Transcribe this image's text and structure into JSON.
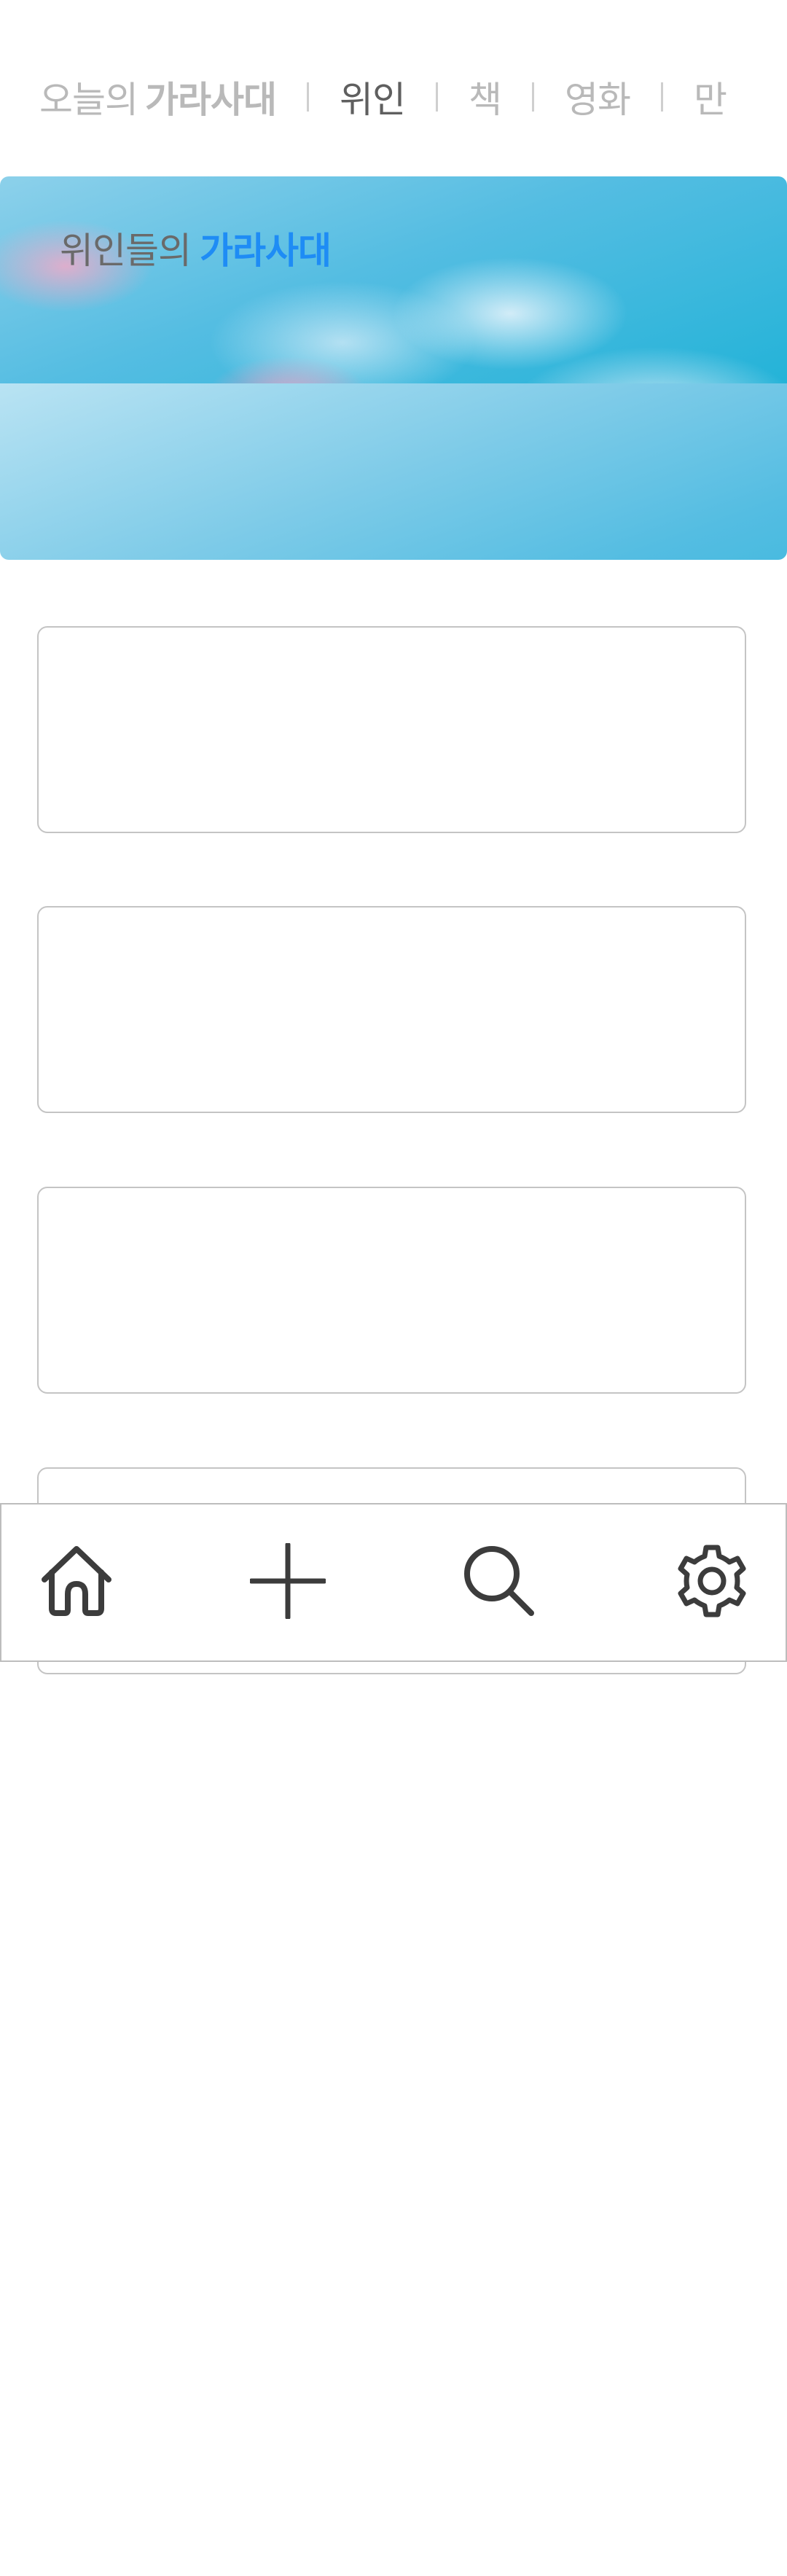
{
  "tabs": [
    {
      "label_light": "오늘의",
      "label_bold": "가라사대",
      "active": false
    },
    {
      "label": "위인",
      "active": true
    },
    {
      "label": "책",
      "active": false
    },
    {
      "label": "영화",
      "active": false
    },
    {
      "label": "만",
      "active": false
    }
  ],
  "hero": {
    "title_part1": "위인들의",
    "title_part2": "가라사대",
    "accent_color": "#1e8cf5"
  },
  "cards": [
    {
      "text": ""
    },
    {
      "text": ""
    },
    {
      "text": ""
    },
    {
      "text": ""
    }
  ],
  "bottom_nav": {
    "items": [
      {
        "icon": "home-icon"
      },
      {
        "icon": "plus-icon"
      },
      {
        "icon": "search-icon"
      },
      {
        "icon": "gear-icon"
      }
    ]
  },
  "colors": {
    "tab_inactive": "#b9b9b9",
    "tab_active": "#5f5f5f",
    "icon": "#3c3c3c",
    "border": "#c4c4c4"
  }
}
